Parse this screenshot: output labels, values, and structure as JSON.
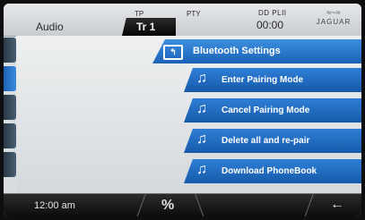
{
  "status": {
    "source": "Audio",
    "tp": "TP",
    "track": "Tr 1",
    "pty": "PTY",
    "dolby": "DD PLII",
    "time": "00:00",
    "brand": "JAGUAR"
  },
  "menu": {
    "title": "Bluetooth Settings",
    "items": [
      {
        "label": "Enter Pairing Mode"
      },
      {
        "label": "Cancel Pairing Mode"
      },
      {
        "label": "Delete all and re-pair"
      },
      {
        "label": "Download PhoneBook"
      }
    ]
  },
  "bottom": {
    "clock": "12:00  am"
  },
  "colors": {
    "accent": "#1f63b5",
    "bar": "#0c0c0c"
  }
}
